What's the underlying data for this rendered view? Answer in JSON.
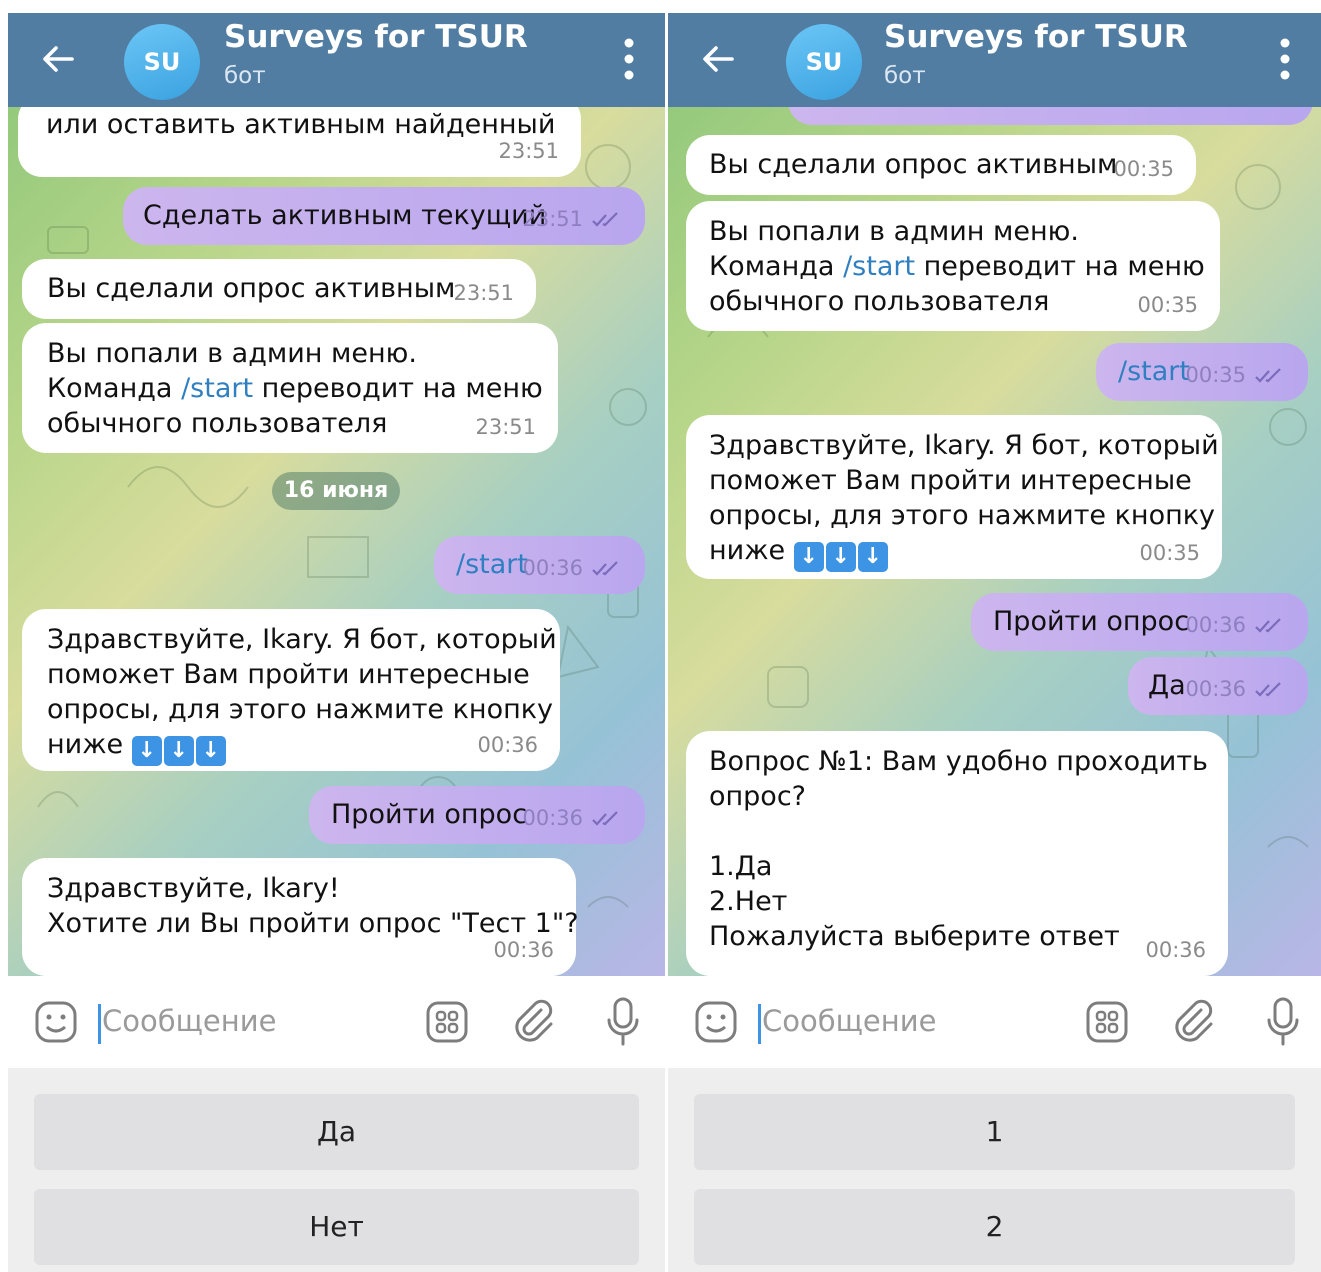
{
  "screens": [
    {
      "header": {
        "back": "back-arrow",
        "avatar": "SU",
        "title": "Surveys for TSUR",
        "subtitle": "бот",
        "menu": "more-vert"
      },
      "messages": [
        {
          "kind": "in",
          "text": "или оставить активным найденный",
          "time": "23:51"
        },
        {
          "kind": "out",
          "text": "Сделать активным текущий",
          "time": "23:51"
        },
        {
          "kind": "in",
          "text": "Вы сделали опрос активным",
          "time": "23:51"
        },
        {
          "kind": "in",
          "line1": "Вы попали в админ меню.",
          "line2_pre": "Команда ",
          "cmd": "/start",
          "line2_post": " переводит на меню",
          "line3": "обычного пользователя",
          "time": "23:51"
        },
        {
          "kind": "date",
          "text": "16 июня"
        },
        {
          "kind": "out",
          "text": "/start",
          "time": "00:36"
        },
        {
          "kind": "in",
          "text": "Здравствуйте, Ikary. Я бот, который\nпоможет Вам пройти интересные\nопросы, для этого нажмите кнопку",
          "text_last": "ниже ",
          "time": "00:36"
        },
        {
          "kind": "out",
          "text": "Пройти опрос",
          "time": "00:36"
        },
        {
          "kind": "in",
          "text": "Здравствуйте, Ikary!\nХотите ли Вы пройти опрос \"Тест 1\"?",
          "time": "00:36"
        }
      ],
      "input": {
        "placeholder": "Сообщение"
      },
      "keyboard": [
        "Да",
        "Нет"
      ]
    },
    {
      "header": {
        "back": "back-arrow",
        "avatar": "SU",
        "title": "Surveys for TSUR",
        "subtitle": "бот",
        "menu": "more-vert"
      },
      "messages": [
        {
          "kind": "in",
          "text": "Вы сделали опрос активным",
          "time": "00:35"
        },
        {
          "kind": "in",
          "line1": "Вы попали в админ меню.",
          "line2_pre": "Команда ",
          "cmd": "/start",
          "line2_post": " переводит на меню",
          "line3": "обычного пользователя",
          "time": "00:35"
        },
        {
          "kind": "out",
          "text": "/start",
          "time": "00:35"
        },
        {
          "kind": "in",
          "text": "Здравствуйте, Ikary. Я бот, который\nпоможет Вам пройти интересные\nопросы, для этого нажмите кнопку",
          "text_last": "ниже ",
          "time": "00:35"
        },
        {
          "kind": "out",
          "text": "Пройти опрос",
          "time": "00:36"
        },
        {
          "kind": "out",
          "text": "Да",
          "time": "00:36"
        },
        {
          "kind": "in",
          "text": "Вопрос №1: Вам удобно проходить\nопрос?\n\n1.Да\n2.Нет\nПожалуйста выберите ответ",
          "time": "00:36"
        }
      ],
      "input": {
        "placeholder": "Сообщение"
      },
      "keyboard": [
        "1",
        "2"
      ]
    }
  ],
  "colors": {
    "header": "#527da3",
    "incoming": "#ffffff",
    "outgoing": "#c4b0ee",
    "link": "#2f7fc1",
    "keyboard_button": "#e0e0e2"
  },
  "icons": [
    "back-arrow-icon",
    "more-vert-icon",
    "emoji-sticker-icon",
    "keyboard-grid-icon",
    "paperclip-icon",
    "microphone-icon",
    "double-check-icon",
    "down-arrow-emoji"
  ]
}
